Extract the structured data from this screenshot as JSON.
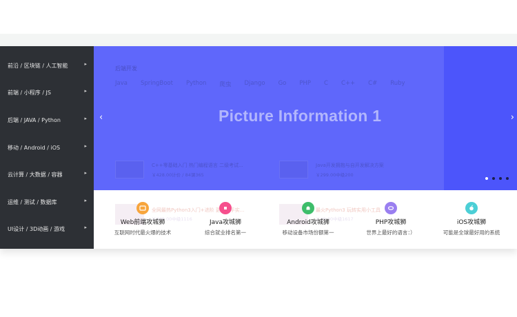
{
  "sidebar": {
    "items": [
      {
        "label": "前沿 / 区块链 / 人工智能"
      },
      {
        "label": "前端 / 小程序 / JS"
      },
      {
        "label": "后端 / JAVA / Python"
      },
      {
        "label": "移动 / Android / iOS"
      },
      {
        "label": "云计算 / 大数据 / 容器"
      },
      {
        "label": "运维 / 测试 / 数据库"
      },
      {
        "label": "UI设计 / 3D动画 / 游戏"
      }
    ],
    "arrow": "▸"
  },
  "banner": {
    "category_title": "后端开发",
    "tags": [
      "Java",
      "SpringBoot",
      "Python",
      "爬虫",
      "Django",
      "Go",
      "PHP",
      "C",
      "C++",
      "C#",
      "Ruby"
    ],
    "caption": "Picture Information 1",
    "prev": "‹",
    "next": "›",
    "courses": [
      {
        "title": "C++零基础入门 热门编程语言 二级考试...",
        "meta": "￥428.00计价 / 84课365"
      },
      {
        "title": "Java开发拥抱与自开发解决方案",
        "meta": "￥299.00中级200"
      }
    ],
    "ghost_courses": [
      {
        "title": "全网最热Python3入门+进阶 更快上手实...",
        "meta": "￥348.00中级1116"
      },
      {
        "title": "最火Python3 玩转实用小工具",
        "meta": "￥49.00中级1617"
      }
    ],
    "dots": 4,
    "active_dot": 0
  },
  "cards": [
    {
      "title": "Web前端攻城狮",
      "desc": "互联网时代最火爆的技术",
      "icon": "web-icon",
      "color": "#f7a53c"
    },
    {
      "title": "Java攻城狮",
      "desc": "综合就业排名第一",
      "icon": "java-icon",
      "color": "#f64f8d"
    },
    {
      "title": "Android攻城狮",
      "desc": "移动设备市场份额第一",
      "icon": "android-icon",
      "color": "#3dbd6a"
    },
    {
      "title": "PHP攻城狮",
      "desc": "世界上最好的语言：）",
      "icon": "php-icon",
      "color": "#9a7ff0"
    },
    {
      "title": "iOS攻城狮",
      "desc": "可能是全球最好用的系统",
      "icon": "ios-icon",
      "color": "#4ccfd6"
    }
  ]
}
